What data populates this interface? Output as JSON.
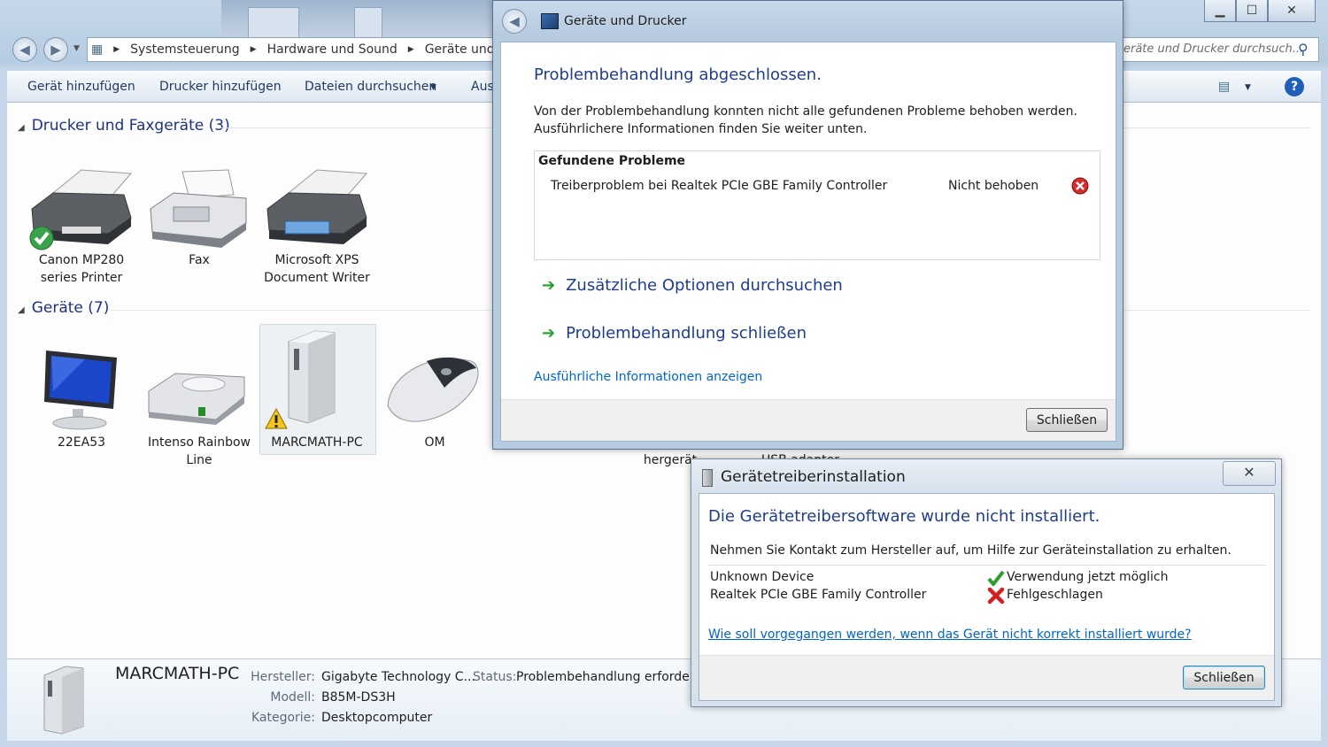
{
  "explorer": {
    "breadcrumb": [
      "Systemsteuerung",
      "Hardware und Sound",
      "Geräte und D"
    ],
    "search_placeholder": "eräte und Drucker durchsuch...",
    "toolbar": {
      "add_device": "Gerät hinzufügen",
      "add_printer": "Drucker hinzufügen",
      "search_files": "Dateien durchsuchen",
      "more": "Aus"
    },
    "printers_group": {
      "title": "Drucker und Faxgeräte (3)",
      "items": [
        {
          "label": "Canon MP280 series Printer"
        },
        {
          "label": "Fax"
        },
        {
          "label": "Microsoft XPS Document Writer"
        }
      ]
    },
    "devices_group": {
      "title": "Geräte (7)",
      "items": [
        {
          "label": "22EA53"
        },
        {
          "label": "Intenso Rainbow Line"
        },
        {
          "label": "MARCMATH-PC"
        },
        {
          "label": "OM"
        }
      ],
      "partial_labels": [
        "hergerät",
        "USB adapter"
      ]
    },
    "details": {
      "name": "MARCMATH-PC",
      "manufacturer_key": "Hersteller:",
      "manufacturer_val": "Gigabyte Technology C...",
      "status_key": "Status:",
      "status_val": "Problembehandlung erforderl",
      "model_key": "Modell:",
      "model_val": "B85M-DS3H",
      "category_key": "Kategorie:",
      "category_val": "Desktopcomputer"
    }
  },
  "troubleshooter": {
    "window_title": "Geräte und Drucker",
    "heading": "Problembehandlung abgeschlossen.",
    "message_line1": "Von der Problembehandlung konnten nicht alle gefundenen Probleme behoben werden.",
    "message_line2": "Ausführlichere Informationen finden Sie weiter unten.",
    "problems_header": "Gefundene Probleme",
    "problem": "Treiberproblem bei Realtek PCIe GBE Family Controller",
    "problem_status": "Nicht behoben",
    "option1": "Zusätzliche Optionen durchsuchen",
    "option2": "Problembehandlung schließen",
    "details_link": "Ausführliche Informationen anzeigen",
    "close_button": "Schließen"
  },
  "driver_install": {
    "window_title": "Gerätetreiberinstallation",
    "heading": "Die Gerätetreibersoftware wurde nicht installiert.",
    "message": "Nehmen Sie Kontakt zum Hersteller auf, um Hilfe zur Geräteinstallation zu erhalten.",
    "rows": [
      {
        "device": "Unknown Device",
        "status": "Verwendung jetzt möglich"
      },
      {
        "device": "Realtek PCIe GBE Family Controller",
        "status": "Fehlgeschlagen"
      }
    ],
    "help_link": "Wie soll vorgegangen werden, wenn das Gerät nicht korrekt installiert wurde?",
    "close_button": "Schließen"
  },
  "colors": {
    "heading_blue": "#1e3d8f",
    "link_blue": "#0066cc",
    "ok_green": "#2a9d2a",
    "error_red": "#d32020"
  }
}
